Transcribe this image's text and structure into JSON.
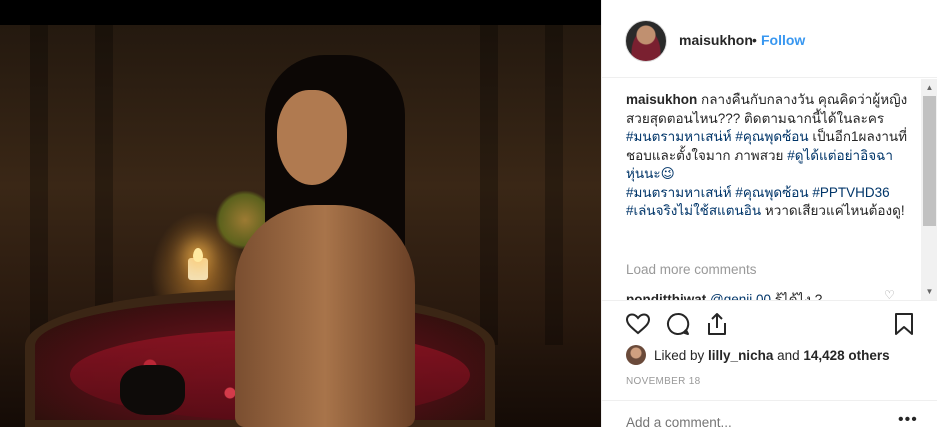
{
  "post": {
    "username": "maisukhon",
    "separator": "•",
    "follow_label": "Follow"
  },
  "caption": {
    "username": "maisukhon",
    "text_1": " กลางคืนกับกลางวัน คุณคิดว่าผู้หญิงสวยสุดตอนไหน??? ติดตามฉากนี้ได้ในละคร",
    "tag_1": "#มนตรามหาเสน่ห์",
    "tag_2": "#คุณพุดซ้อน",
    "text_2": " เป็นอีก1ผลงานที่ชอบและตั้งใจมาก ภาพสวย ",
    "tag_3": "#ดูได้แต่อย่าอิจฉาหุ่นนะ😉",
    "tag_4": "#มนตรามหาเสน่ห์",
    "tag_5": "#คุณพุดซ้อน",
    "tag_6": "#PPTVHD36",
    "tag_7": "#เล่นจริงไม่ใช้สแตนอิน",
    "text_3": " หวาดเสียวแค่ไหนต้องดู!"
  },
  "comments": {
    "load_more": "Load more comments",
    "items": [
      {
        "username": "ponditthiwat",
        "mention": "@genii.00",
        "text": " รู้ได้ไง ?"
      }
    ]
  },
  "icons": {
    "like": "heart-icon",
    "comment": "comment-icon",
    "share": "share-icon",
    "save": "bookmark-icon",
    "more": "more-options-icon"
  },
  "likes": {
    "prefix": "Liked by ",
    "user": "lilly_nicha",
    "middle": " and ",
    "count": "14,428 others"
  },
  "date": "NOVEMBER 18",
  "add_comment": {
    "placeholder": "Add a comment...",
    "more_label": "•••"
  },
  "colors": {
    "link_blue": "#3897f0",
    "hashtag": "#003569",
    "muted": "#999999",
    "text": "#262626"
  }
}
